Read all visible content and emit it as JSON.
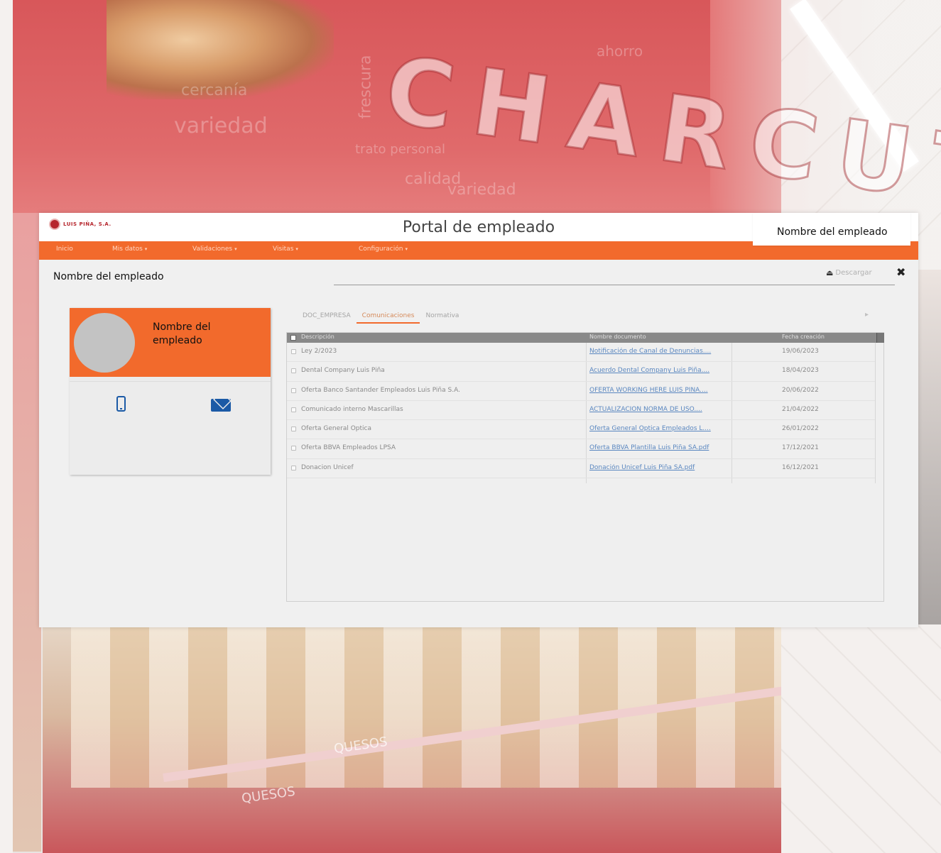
{
  "background": {
    "wall_word": "CHARCUTERIA",
    "decor_words": [
      "variedad",
      "cercanía",
      "frescura",
      "ahorro",
      "calidad",
      "trato personal"
    ],
    "counter_label": "QUESOS"
  },
  "header": {
    "logo_text": "LUIS PIÑA, S.A.",
    "title": "Portal de empleado",
    "employee_name": "Nombre del empleado"
  },
  "nav": {
    "items": [
      {
        "label": "Inicio",
        "caret": false
      },
      {
        "label": "Mis datos",
        "caret": true
      },
      {
        "label": "Validaciones",
        "caret": true
      },
      {
        "label": "Visitas",
        "caret": true
      },
      {
        "label": "Configuración",
        "caret": true
      }
    ],
    "caret_glyph": "▾"
  },
  "page": {
    "employee_title": "Nombre del empleado",
    "download_label": "Descargar",
    "close_label": "✖"
  },
  "profile": {
    "name": "Nombre del empleado"
  },
  "tabs": {
    "items": [
      {
        "label": "DOC_EMPRESA",
        "active": false
      },
      {
        "label": "Comunicaciones",
        "active": true
      },
      {
        "label": "Normativa",
        "active": false
      }
    ],
    "right_glyph": "▸"
  },
  "table": {
    "columns": {
      "description": "Descripción",
      "document": "Nombre documento",
      "date": "Fecha creación"
    },
    "rows": [
      {
        "description": "Ley 2/2023",
        "document": "Notificación de Canal de Denuncias....",
        "date": "19/06/2023"
      },
      {
        "description": "Dental Company Luis Piña",
        "document": "Acuerdo Dental Company Luis Piña....",
        "date": "18/04/2023"
      },
      {
        "description": "Oferta Banco Santander Empleados Luis Piña S.A.",
        "document": "OFERTA WORKING HERE LUIS PIÑA....",
        "date": "20/06/2022"
      },
      {
        "description": "Comunicado interno Mascarillas",
        "document": "ACTUALIZACIÓN NORMA DE USO....",
        "date": "21/04/2022"
      },
      {
        "description": "Oferta General Óptica",
        "document": "Oferta General Óptica Empleados L....",
        "date": "26/01/2022"
      },
      {
        "description": "Oferta BBVA Empleados LPSA",
        "document": "Oferta BBVA Plantilla Luis Piña SA.pdf",
        "date": "17/12/2021"
      },
      {
        "description": "Donacion Unicef",
        "document": "Donación Unicef Luis Piña SA.pdf",
        "date": "16/12/2021"
      }
    ]
  },
  "colors": {
    "brand_orange": "#f26a2c",
    "brand_red": "#b6262d",
    "link_blue": "#5a87c0",
    "icon_blue": "#1b5aa6"
  }
}
